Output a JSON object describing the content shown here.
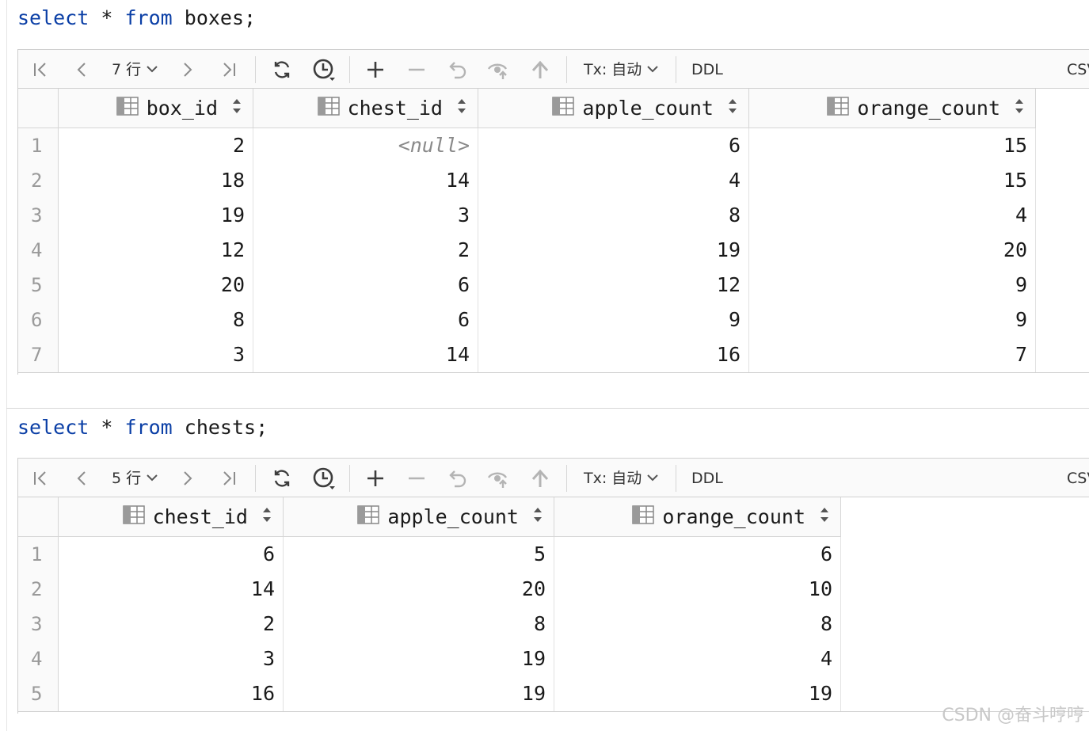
{
  "queries": [
    {
      "sql": {
        "kw1": "select",
        "star": "*",
        "kw2": "from",
        "rest": "boxes;"
      },
      "toolbar": {
        "rows_label": "7 行",
        "tx_label": "Tx: 自动",
        "ddl_label": "DDL",
        "csv_label": "CSV"
      },
      "columns": [
        "box_id",
        "chest_id",
        "apple_count",
        "orange_count"
      ],
      "rows": [
        {
          "n": "1",
          "cells": [
            "2",
            "<null>",
            "6",
            "15"
          ]
        },
        {
          "n": "2",
          "cells": [
            "18",
            "14",
            "4",
            "15"
          ]
        },
        {
          "n": "3",
          "cells": [
            "19",
            "3",
            "8",
            "4"
          ]
        },
        {
          "n": "4",
          "cells": [
            "12",
            "2",
            "19",
            "20"
          ]
        },
        {
          "n": "5",
          "cells": [
            "20",
            "6",
            "12",
            "9"
          ]
        },
        {
          "n": "6",
          "cells": [
            "8",
            "6",
            "9",
            "9"
          ]
        },
        {
          "n": "7",
          "cells": [
            "3",
            "14",
            "16",
            "7"
          ]
        }
      ]
    },
    {
      "sql": {
        "kw1": "select",
        "star": "*",
        "kw2": "from",
        "rest": "chests;"
      },
      "toolbar": {
        "rows_label": "5 行",
        "tx_label": "Tx: 自动",
        "ddl_label": "DDL",
        "csv_label": "CSV"
      },
      "columns": [
        "chest_id",
        "apple_count",
        "orange_count"
      ],
      "rows": [
        {
          "n": "1",
          "cells": [
            "6",
            "5",
            "6"
          ]
        },
        {
          "n": "2",
          "cells": [
            "14",
            "20",
            "10"
          ]
        },
        {
          "n": "3",
          "cells": [
            "2",
            "8",
            "8"
          ]
        },
        {
          "n": "4",
          "cells": [
            "3",
            "19",
            "4"
          ]
        },
        {
          "n": "5",
          "cells": [
            "16",
            "19",
            "19"
          ]
        }
      ]
    }
  ],
  "watermark": "CSDN @奋斗哼哼",
  "icons": [
    "first-page-icon",
    "prev-page-icon",
    "chevron-down-icon",
    "next-page-icon",
    "last-page-icon",
    "refresh-icon",
    "history-icon",
    "add-row-icon",
    "delete-row-icon",
    "revert-icon",
    "preview-icon",
    "submit-icon",
    "column-icon",
    "sort-icon"
  ],
  "colors": {
    "keyword": "#0b3fa6",
    "null_text": "#8a8a8a",
    "row_number": "#9a9a9a"
  }
}
